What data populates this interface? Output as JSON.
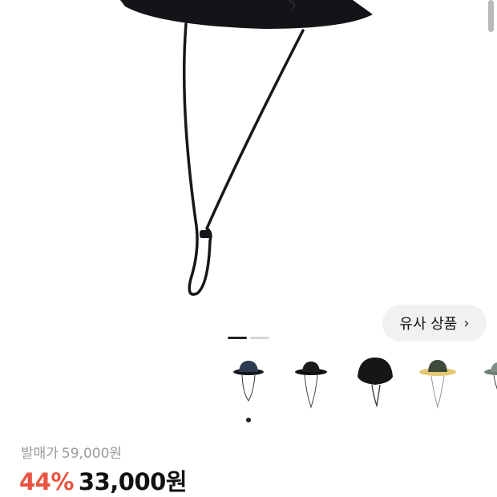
{
  "similar_button": {
    "label": "유사 상품",
    "chevron": "›"
  },
  "gallery": {
    "slide_count": 2,
    "active_slide": 1
  },
  "thumbnails": [
    {
      "name": "navy-bucket-hat"
    },
    {
      "name": "black-bucket-hat"
    },
    {
      "name": "black-boonie-hat"
    },
    {
      "name": "beige-safari-hat"
    },
    {
      "name": "camo-hat"
    }
  ],
  "price": {
    "original_label": "발매가",
    "original_value": "59,000원",
    "discount": "44%",
    "final": "33,000원"
  },
  "colors": {
    "accent": "#e8533f",
    "text": "#111111",
    "muted": "#9a9a9a"
  }
}
